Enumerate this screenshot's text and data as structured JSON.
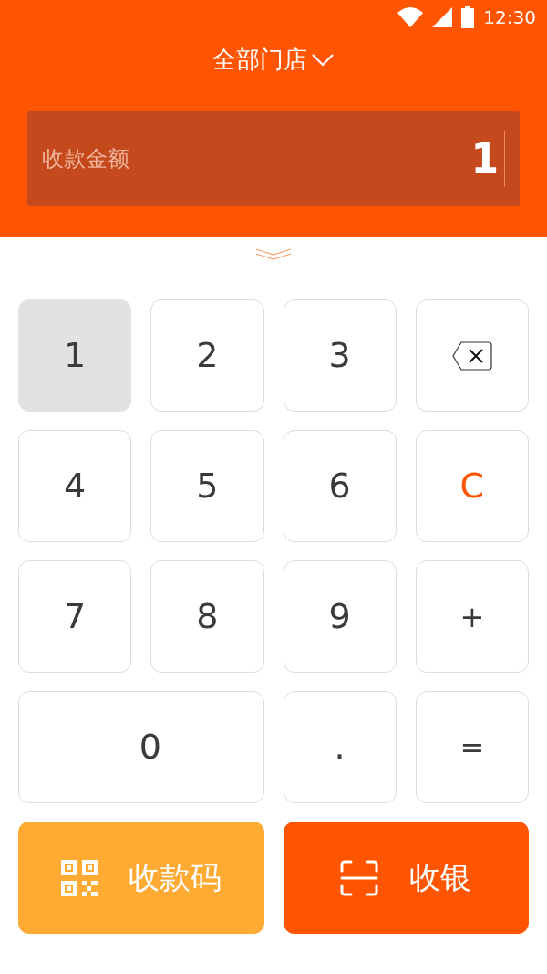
{
  "status_bar": {
    "time": "12:30"
  },
  "header": {
    "title": "全部门店",
    "amount_field": {
      "placeholder": "收款金额",
      "value": "1"
    }
  },
  "keypad": [
    {
      "label": "1",
      "kind": "digit",
      "selected": true
    },
    {
      "label": "2",
      "kind": "digit",
      "selected": false
    },
    {
      "label": "3",
      "kind": "digit",
      "selected": false
    },
    {
      "kind": "backspace",
      "selected": false
    },
    {
      "label": "4",
      "kind": "digit",
      "selected": false
    },
    {
      "label": "5",
      "kind": "digit",
      "selected": false
    },
    {
      "label": "6",
      "kind": "digit",
      "selected": false
    },
    {
      "label": "C",
      "kind": "clear",
      "selected": false
    },
    {
      "label": "7",
      "kind": "digit",
      "selected": false
    },
    {
      "label": "8",
      "kind": "digit",
      "selected": false
    },
    {
      "label": "9",
      "kind": "digit",
      "selected": false
    },
    {
      "label": "+",
      "kind": "operator",
      "selected": false
    },
    {
      "label": "0",
      "kind": "zero",
      "selected": false
    },
    {
      "label": ".",
      "kind": "digit",
      "selected": false
    },
    {
      "label": "=",
      "kind": "operator",
      "selected": false
    }
  ],
  "actions": [
    {
      "label": "收款码",
      "kind": "qr"
    },
    {
      "label": "收银",
      "kind": "scan"
    }
  ]
}
